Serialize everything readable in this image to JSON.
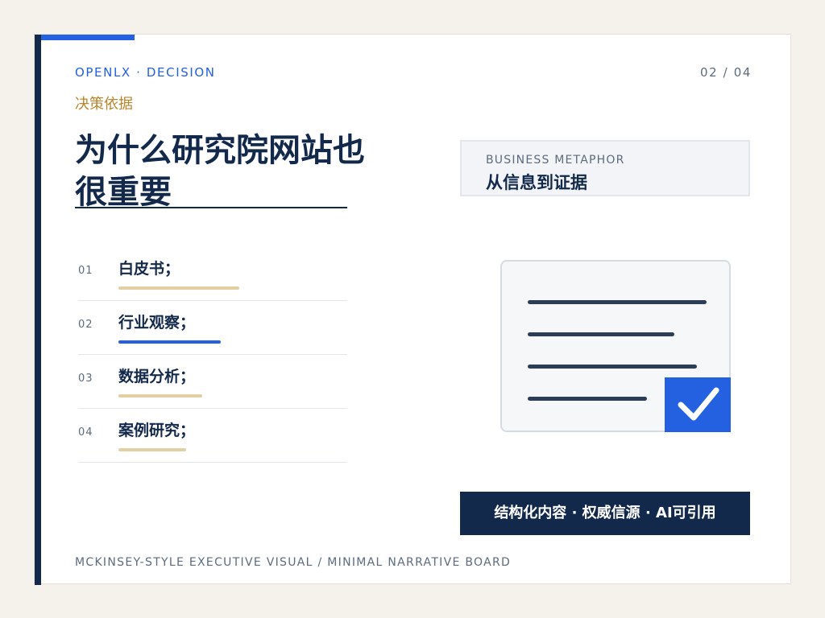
{
  "brand": "OPENLX · DECISION",
  "page_number": "02 / 04",
  "section_label": "决策依据",
  "title": "为什么研究院网站也很重要",
  "list": [
    {
      "num": "01",
      "label": "白皮书；",
      "bar_color": "#e2cfa4",
      "fill": 0.45
    },
    {
      "num": "02",
      "label": "行业观察；",
      "bar_color": "#2361e0",
      "fill": 0.38
    },
    {
      "num": "03",
      "label": "数据分析；",
      "bar_color": "#e2cfa4",
      "fill": 0.31
    },
    {
      "num": "04",
      "label": "案例研究；",
      "bar_color": "#e2cfa4",
      "fill": 0.25
    }
  ],
  "metaphor": {
    "eyebrow": "BUSINESS METAPHOR",
    "title": "从信息到证据"
  },
  "document_icon": {
    "icon": "document-check-icon",
    "accent": "#2361e0"
  },
  "tagline": "结构化内容 · 权威信源 · AI可引用",
  "footer": "MCKINSEY-STYLE EXECUTIVE VISUAL / MINIMAL NARRATIVE BOARD",
  "colors": {
    "navy": "#13294b",
    "blue": "#2361e0",
    "gold": "#b8862e",
    "sand": "#e2cfa4"
  }
}
